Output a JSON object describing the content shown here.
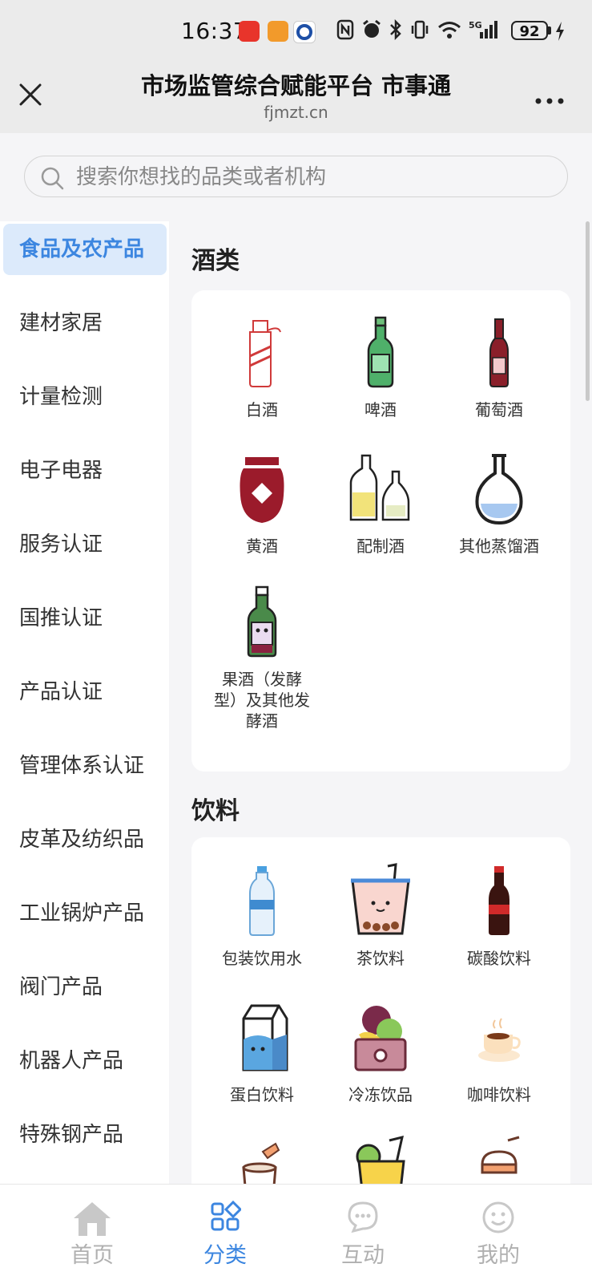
{
  "status_bar": {
    "time": "16:37",
    "battery": "92"
  },
  "header": {
    "title": "市场监管综合赋能平台 市事通",
    "domain": "fjmzt.cn"
  },
  "search": {
    "placeholder": "搜索你想找的品类或者机构"
  },
  "sidebar": {
    "active_index": 0,
    "items": [
      {
        "label": "食品及农产品"
      },
      {
        "label": "建材家居"
      },
      {
        "label": "计量检测"
      },
      {
        "label": "电子电器"
      },
      {
        "label": "服务认证"
      },
      {
        "label": "国推认证"
      },
      {
        "label": "产品认证"
      },
      {
        "label": "管理体系认证"
      },
      {
        "label": "皮革及纺织品"
      },
      {
        "label": "工业锅炉产品"
      },
      {
        "label": "阀门产品"
      },
      {
        "label": "机器人产品"
      },
      {
        "label": "特殊钢产品"
      }
    ]
  },
  "sections": [
    {
      "title": "酒类",
      "items": [
        {
          "label": "白酒",
          "icon": "baijiu-bottle-icon"
        },
        {
          "label": "啤酒",
          "icon": "beer-bottle-icon"
        },
        {
          "label": "葡萄酒",
          "icon": "wine-bottle-icon"
        },
        {
          "label": "黄酒",
          "icon": "huangjiu-jar-icon"
        },
        {
          "label": "配制酒",
          "icon": "mixed-liquor-bottles-icon"
        },
        {
          "label": "其他蒸馏酒",
          "icon": "distilled-flask-icon"
        },
        {
          "label": "果酒（发酵型）及其他发酵酒",
          "icon": "fruit-wine-bottle-icon"
        }
      ]
    },
    {
      "title": "饮料",
      "items": [
        {
          "label": "包装饮用水",
          "icon": "water-bottle-icon"
        },
        {
          "label": "茶饮料",
          "icon": "bubble-tea-icon"
        },
        {
          "label": "碳酸饮料",
          "icon": "cola-bottle-icon"
        },
        {
          "label": "蛋白饮料",
          "icon": "milk-carton-icon"
        },
        {
          "label": "冷冻饮品",
          "icon": "ice-cream-icon"
        },
        {
          "label": "咖啡饮料",
          "icon": "coffee-cup-icon"
        }
      ]
    }
  ],
  "tabbar": {
    "active_index": 1,
    "tabs": [
      {
        "label": "首页",
        "icon": "home-icon"
      },
      {
        "label": "分类",
        "icon": "category-icon"
      },
      {
        "label": "互动",
        "icon": "chat-icon"
      },
      {
        "label": "我的",
        "icon": "profile-icon"
      }
    ]
  },
  "colors": {
    "accent": "#3c86e0",
    "active_bg": "#dceafb",
    "header_bg": "#ebebeb"
  }
}
